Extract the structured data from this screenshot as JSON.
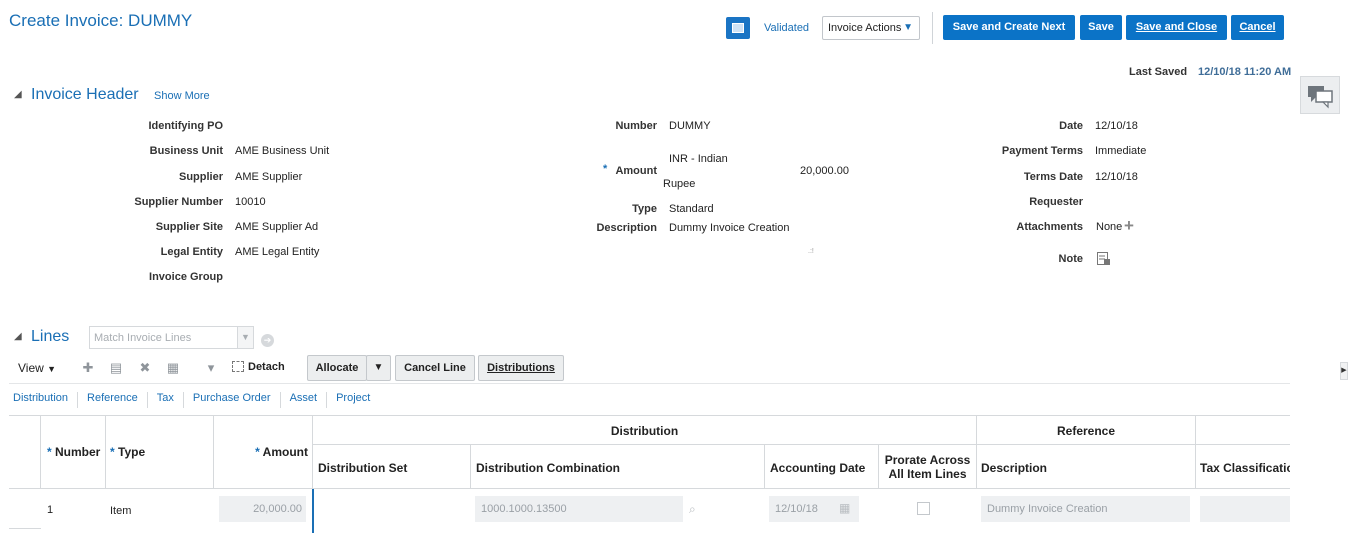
{
  "page_title": "Create Invoice: DUMMY",
  "toolbar": {
    "status": "Validated",
    "actions_label": "Invoice Actions",
    "save_create_next": "Save and Create Next",
    "save": "Save",
    "save_close": "Save and Close",
    "cancel": "Cancel"
  },
  "last_saved": {
    "label": "Last Saved",
    "value": "12/10/18 11:20 AM"
  },
  "header_section": {
    "title": "Invoice Header",
    "show_more": "Show More",
    "col1": [
      {
        "label": "Identifying PO",
        "value": ""
      },
      {
        "label": "Business Unit",
        "value": "AME Business Unit"
      },
      {
        "label": "Supplier",
        "value": "AME Supplier"
      },
      {
        "label": "Supplier Number",
        "value": "10010"
      },
      {
        "label": "Supplier Site",
        "value": "AME Supplier Ad"
      },
      {
        "label": "Legal Entity",
        "value": "AME Legal Entity"
      },
      {
        "label": "Invoice Group",
        "value": ""
      }
    ],
    "col2": {
      "number_label": "Number",
      "number_value": "DUMMY",
      "amount_label": "Amount",
      "currency_line1": "INR - Indian",
      "currency_line2": "Rupee",
      "amount_value": "20,000.00",
      "type_label": "Type",
      "type_value": "Standard",
      "description_label": "Description",
      "description_value": "Dummy Invoice Creation"
    },
    "col3": {
      "date_label": "Date",
      "date_value": "12/10/18",
      "payment_terms_label": "Payment Terms",
      "payment_terms_value": "Immediate",
      "terms_date_label": "Terms Date",
      "terms_date_value": "12/10/18",
      "requester_label": "Requester",
      "requester_value": "",
      "attachments_label": "Attachments",
      "attachments_value": "None",
      "note_label": "Note"
    }
  },
  "lines_section": {
    "title": "Lines",
    "match_placeholder": "Match Invoice Lines",
    "view_label": "View",
    "detach_label": "Detach",
    "allocate_label": "Allocate",
    "cancel_line_label": "Cancel Line",
    "distributions_label": "Distributions",
    "tabs": [
      "Distribution",
      "Reference",
      "Tax",
      "Purchase Order",
      "Asset",
      "Project"
    ],
    "group_headers": {
      "distribution": "Distribution",
      "reference": "Reference"
    },
    "columns": {
      "number": "Number",
      "type": "Type",
      "amount": "Amount",
      "distribution_set": "Distribution Set",
      "distribution_combination": "Distribution Combination",
      "accounting_date": "Accounting Date",
      "prorate": "Prorate Across All Item Lines",
      "description": "Description",
      "tax_classification": "Tax Classificatio"
    },
    "rows": [
      {
        "number": "1",
        "type": "Item",
        "amount": "20,000.00",
        "distribution_combination": "1000.1000.13500",
        "accounting_date": "12/10/18",
        "description": "Dummy Invoice Creation"
      }
    ]
  }
}
